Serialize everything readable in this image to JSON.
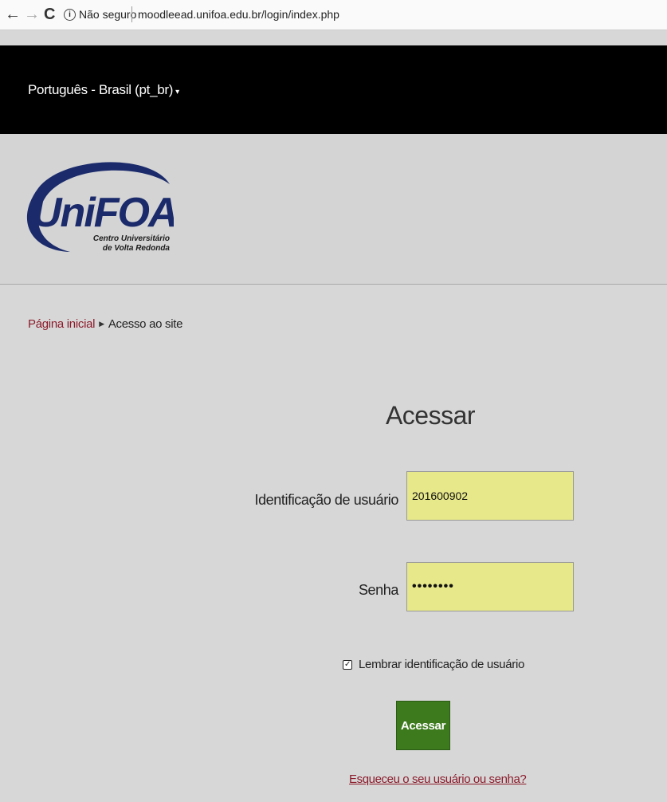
{
  "browser": {
    "back_icon": "←",
    "forward_icon": "→",
    "reload_icon": "C",
    "security_label": "Não seguro",
    "url": "moodleead.unifoa.edu.br/login/index.php"
  },
  "topbar": {
    "language": "Português - Brasil (pt_br)",
    "language_caret": "▾"
  },
  "logo": {
    "name": "UniFOA",
    "line1": "Centro Universitário",
    "line2": "de Volta Redonda",
    "colors": {
      "primary": "#1a2a6b",
      "swoosh": "#1a2a6b"
    }
  },
  "breadcrumb": {
    "home": "Página inicial",
    "separator": "▶",
    "current": "Acesso ao site"
  },
  "login": {
    "title": "Acessar",
    "username_label": "Identificação de usuário",
    "username_value": "201600902",
    "password_label": "Senha",
    "password_value": "••••••••",
    "remember_label": "Lembrar identificação de usuário",
    "remember_checked_glyph": "✓",
    "submit_label": "Acessar",
    "forgot_link": "Esqueceu o seu usuário ou senha?"
  },
  "colors": {
    "background": "#d7d7d7",
    "topbar": "#000000",
    "input_fill": "#e7e88a",
    "button": "#3d7a1d",
    "link": "#8b1b2b"
  }
}
